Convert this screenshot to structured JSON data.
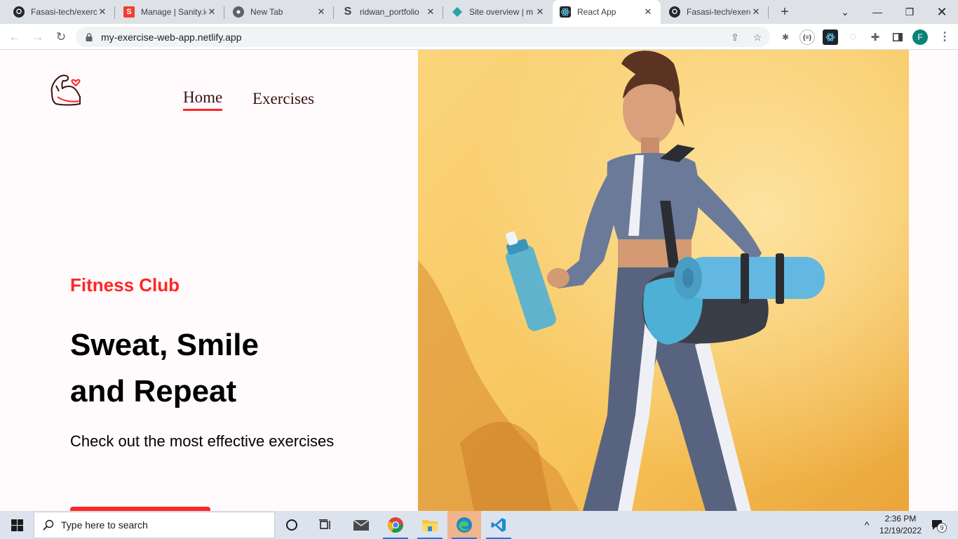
{
  "browser": {
    "tabs": [
      {
        "title": "Fasasi-tech/exerc",
        "icon": "github-icon",
        "active": false
      },
      {
        "title": "Manage | Sanity.io",
        "icon": "sanity-icon",
        "active": false
      },
      {
        "title": "New Tab",
        "icon": "chrome-icon",
        "active": false
      },
      {
        "title": "ridwan_portfolio",
        "icon": "sanity-s-icon",
        "active": false
      },
      {
        "title": "Site overview | m",
        "icon": "netlify-icon",
        "active": false
      },
      {
        "title": "React App",
        "icon": "react-icon",
        "active": true
      },
      {
        "title": "Fasasi-tech/exerc",
        "icon": "github-icon",
        "active": false
      }
    ],
    "url": "my-exercise-web-app.netlify.app",
    "profile_initial": "F",
    "extension_badge": "{≡}"
  },
  "page": {
    "nav": {
      "home_label": "Home",
      "exercises_label": "Exercises"
    },
    "hero": {
      "eyebrow": "Fitness Club",
      "headline_line1": "Sweat, Smile",
      "headline_line2": "and Repeat",
      "subtitle": "Check out the most effective exercises"
    },
    "colors": {
      "accent": "#ff2625",
      "page_bg": "#fffafb",
      "hero_bg": "#f7c45a"
    }
  },
  "taskbar": {
    "search_placeholder": "Type here to search",
    "time": "2:36 PM",
    "date": "12/19/2022",
    "notification_count": "9"
  }
}
